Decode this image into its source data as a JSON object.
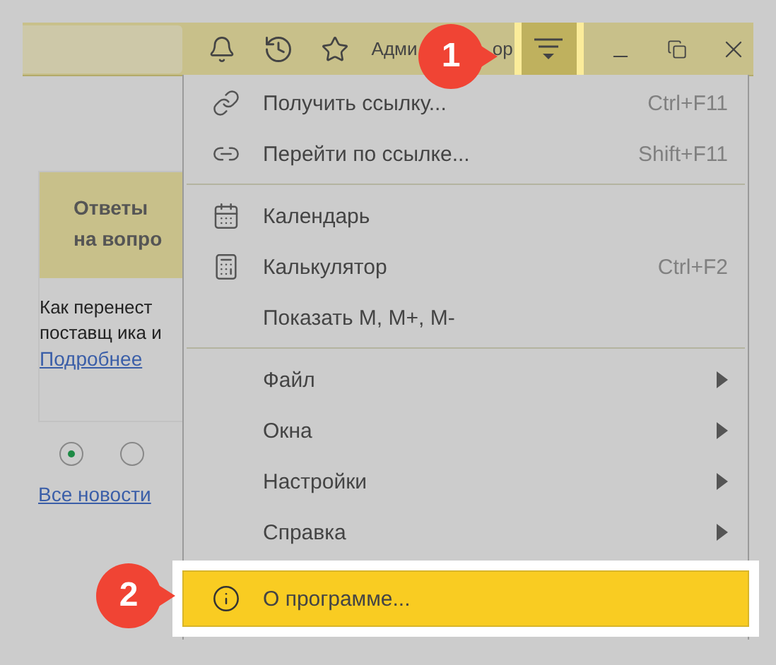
{
  "top_bar": {
    "user_name_visible_start": "Адми",
    "user_name_visible_end": "ор",
    "callout": "1"
  },
  "news_card": {
    "heading_lines": [
      "Ответы",
      "на вопро"
    ],
    "text_lines": [
      "Как перенест",
      "поставщ ика и"
    ],
    "link": "Подробнее"
  },
  "pager": [
    {
      "selected": true
    },
    {
      "selected": false
    }
  ],
  "all_news_link": "Все новости",
  "menu": {
    "items": [
      {
        "kind": "action",
        "label": "Получить ссылку...",
        "shortcut": "Ctrl+F11",
        "selected": false
      },
      {
        "kind": "action",
        "label": "Перейти по ссылке...",
        "shortcut": "Shift+F11",
        "selected": false
      },
      {
        "kind": "separator"
      },
      {
        "kind": "action",
        "label": "Календарь",
        "selected": false
      },
      {
        "kind": "action",
        "label": "Калькулятор",
        "shortcut": "Ctrl+F2",
        "selected": false
      },
      {
        "kind": "action",
        "label": "Показать M, M+, M-",
        "selected": false
      },
      {
        "kind": "separator"
      },
      {
        "kind": "submenu",
        "label": "Файл",
        "selected": false
      },
      {
        "kind": "submenu",
        "label": "Окна",
        "selected": false
      },
      {
        "kind": "submenu",
        "label": "Настройки",
        "selected": false
      },
      {
        "kind": "submenu",
        "label": "Справка",
        "selected": false
      },
      {
        "kind": "action",
        "label": "О программе...",
        "selected": true
      }
    ]
  },
  "menu_callout": "2"
}
